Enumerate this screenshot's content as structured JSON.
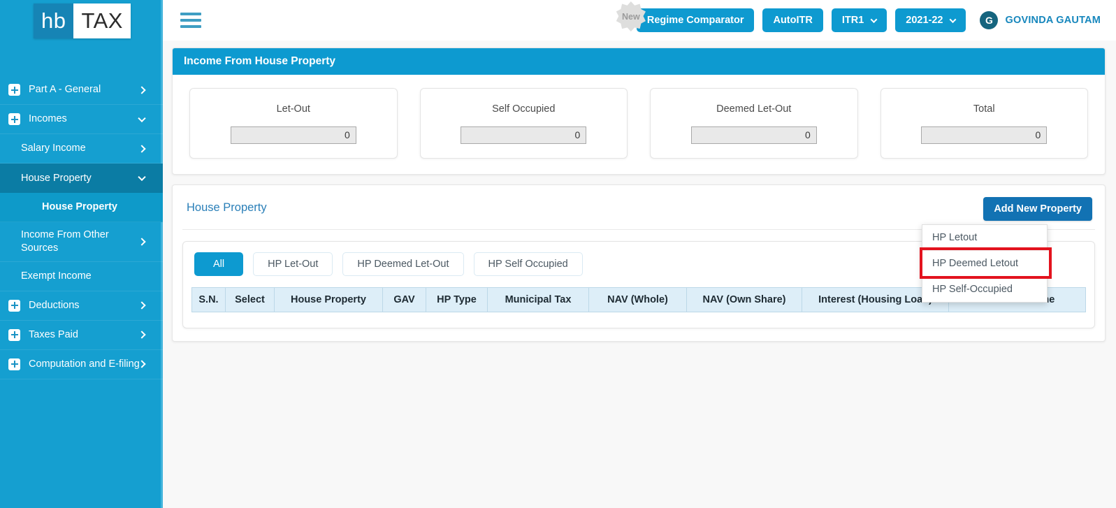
{
  "brand": {
    "logo_primary": "hb",
    "logo_secondary": "TAX",
    "accent": "#0d9ad0",
    "sidebar_bg": "#159fd0"
  },
  "topbar": {
    "menu_icon": "hamburger-icon",
    "new_badge": "New",
    "regime_comparator": "Regime Comparator",
    "auto_itr": "AutoITR",
    "itr_form": "ITR1",
    "assessment_year": "2021-22",
    "user_initial": "G",
    "user_name": "GOVINDA GAUTAM"
  },
  "sidebar": {
    "items": [
      {
        "label": "Part A - General",
        "level": 1,
        "icon": "plus-box-icon",
        "chevron": "right",
        "active": false
      },
      {
        "label": "Incomes",
        "level": 1,
        "icon": "plus-box-icon",
        "chevron": "down",
        "active": false
      },
      {
        "label": "Salary Income",
        "level": 2,
        "icon": "",
        "chevron": "right",
        "active": false
      },
      {
        "label": "House Property",
        "level": 2,
        "icon": "",
        "chevron": "down",
        "active": true
      },
      {
        "label": "House Property",
        "level": 3,
        "icon": "",
        "chevron": "",
        "active": false
      },
      {
        "label": "Income From Other Sources",
        "level": 2,
        "icon": "",
        "chevron": "right",
        "active": false
      },
      {
        "label": "Exempt Income",
        "level": 2,
        "icon": "",
        "chevron": "",
        "active": false
      },
      {
        "label": "Deductions",
        "level": 1,
        "icon": "plus-box-icon",
        "chevron": "right",
        "active": false
      },
      {
        "label": "Taxes Paid",
        "level": 1,
        "icon": "plus-box-icon",
        "chevron": "right",
        "active": false
      },
      {
        "label": "Computation and E-filing",
        "level": 1,
        "icon": "plus-box-icon",
        "chevron": "right",
        "active": false
      }
    ]
  },
  "income_panel": {
    "title": "Income From House Property",
    "cards": [
      {
        "label": "Let-Out",
        "value": "0"
      },
      {
        "label": "Self Occupied",
        "value": "0"
      },
      {
        "label": "Deemed Let-Out",
        "value": "0"
      },
      {
        "label": "Total",
        "value": "0"
      }
    ]
  },
  "hp_panel": {
    "title": "House Property",
    "add_button": "Add New Property",
    "dropdown": {
      "open": true,
      "items": [
        {
          "label": "HP Letout",
          "highlighted": false
        },
        {
          "label": "HP Deemed Letout",
          "highlighted": true
        },
        {
          "label": "HP Self-Occupied",
          "highlighted": false
        }
      ],
      "highlight_color": "#e3131e"
    },
    "filters": [
      {
        "label": "All",
        "active": true
      },
      {
        "label": "HP Let-Out",
        "active": false
      },
      {
        "label": "HP Deemed Let-Out",
        "active": false
      },
      {
        "label": "HP Self Occupied",
        "active": false
      }
    ],
    "table": {
      "columns": [
        "S.N.",
        "Select",
        "House Property",
        "GAV",
        "HP Type",
        "Municipal Tax",
        "NAV (Whole)",
        "NAV (Own Share)",
        "Interest (Housing Loan)",
        "Taxable Income"
      ],
      "rows": []
    }
  }
}
